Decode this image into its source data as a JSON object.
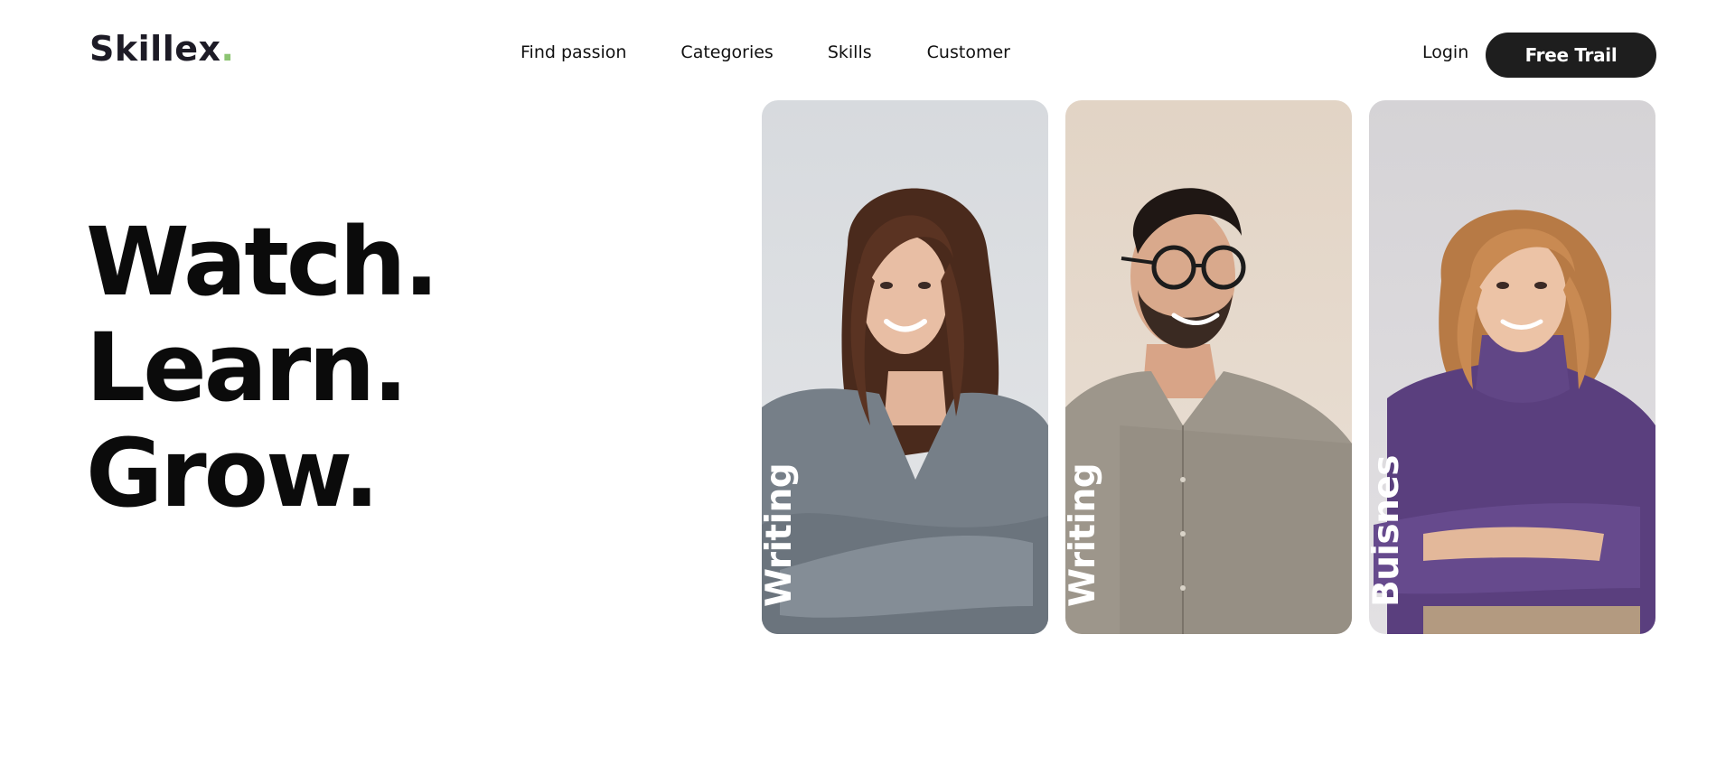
{
  "brand": {
    "name": "Skillex",
    "dot": "."
  },
  "nav": {
    "items": [
      {
        "label": "Find passion"
      },
      {
        "label": "Categories"
      },
      {
        "label": "Skills"
      },
      {
        "label": "Customer"
      }
    ]
  },
  "header": {
    "login_label": "Login",
    "cta_label": "Free Trail"
  },
  "hero": {
    "lines": [
      "Watch.",
      "Learn.",
      "Grow."
    ]
  },
  "cards": [
    {
      "label": "Writing",
      "icon": "woman-gray-sweater-portrait"
    },
    {
      "label": "Writing",
      "icon": "man-glasses-portrait"
    },
    {
      "label": "Buisnes",
      "icon": "woman-purple-sweater-portrait"
    }
  ],
  "colors": {
    "accent": "#8cc472",
    "cta_bg": "#1e1e1e",
    "text": "#111111"
  }
}
